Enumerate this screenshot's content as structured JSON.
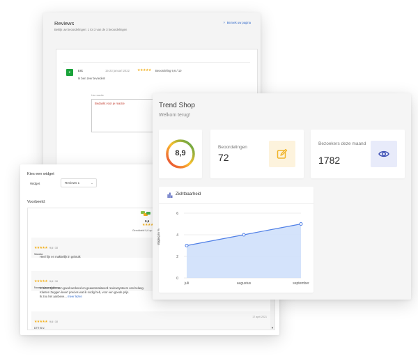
{
  "reviews_panel": {
    "title": "Reviews",
    "subtitle": "Bekijk uw beoordelingen: 1 tot 3 van de 3 beoordelingen",
    "visit_link": "Bezoek uw pagina",
    "review": {
      "avatar_letter": "E",
      "name": "Eric",
      "date": "15-23 januari 2022",
      "stars": "★★★★★",
      "score": "Beoordeling 9,6 / 10",
      "text": "Ik ben zeer tevreden!"
    },
    "reply_label": "Uw reactie",
    "reply_placeholder": "Bedankt voor je reactie"
  },
  "widget_panel": {
    "choose_label": "Kies een widget",
    "widget_label": "Widget",
    "widget_select_value": "Reviews 1",
    "preview_label": "Voorbeeld:",
    "preview_score": "9,6",
    "preview_stars": "★★★★★",
    "preview_generated": "Gemiddeld 9,6 op basis van reviews",
    "reviews": [
      {
        "stars": "★★★★★",
        "score": "9,6 / 10",
        "name": "Sandra",
        "text": [
          "Heel fijn en makkelijk in gebruik"
        ]
      },
      {
        "stars": "★★★★★",
        "score": "9,6 / 10",
        "name": "Noortuis accountancy",
        "text": [
          "In deze tijd is een goed werkend en geautomatiseerd reviewsysteem van belang.",
          "Klanten Zeggen levert precies wat ik nodig heb, voor een goede prijs.",
          "Ik zou het aanbeve..."
        ],
        "more": "meer lezen"
      },
      {
        "stars": "★★★★★",
        "score": "9,6 / 10",
        "name": "DTT B.V.",
        "date": "17 april 2021"
      }
    ]
  },
  "dashboard": {
    "shop_name": "Trend Shop",
    "welcome": "Welkom terug!",
    "score_value": "8,9",
    "reviews_label": "Beoordelingen",
    "reviews_count": "72",
    "visitors_label": "Bezoekers deze maand",
    "visitors_count": "1782",
    "icons": {
      "reviews": "edit-icon",
      "visitors": "eye-icon",
      "chart": "bar-chart-icon"
    },
    "colors": {
      "reviews_icon": "#f0b429",
      "visitors_icon": "#3f51b5",
      "chart_line": "#4f7fe6",
      "chart_fill": "#cfe0fb"
    },
    "chart_title": "Zichtbaarheid"
  },
  "chart_data": {
    "type": "area",
    "title": "Zichtbaarheid",
    "categories": [
      "juli",
      "augustus",
      "september"
    ],
    "series": [
      {
        "values": [
          3,
          4,
          5
        ]
      }
    ],
    "ylabel": "stijging in %",
    "xlabel": "",
    "ylim": [
      0,
      6
    ],
    "yticks": [
      "0",
      "2",
      "4",
      "6"
    ],
    "grid": true
  }
}
